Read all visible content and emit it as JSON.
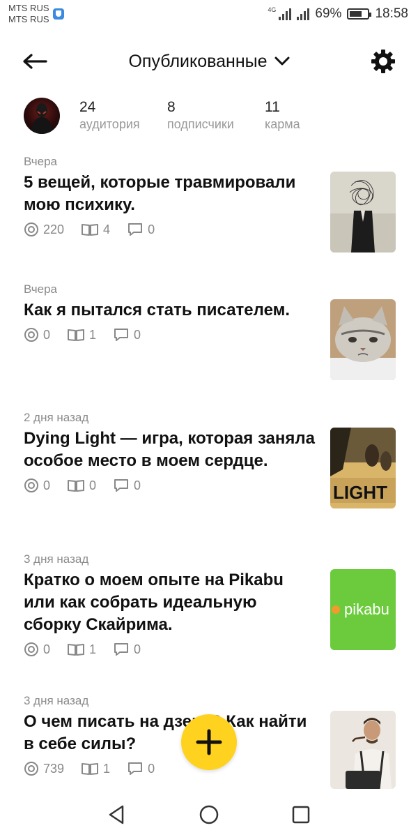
{
  "status_bar": {
    "carrier_1": "MTS RUS",
    "carrier_2": "MTS RUS",
    "network": "4G",
    "battery": "69%",
    "battery_level": 0.69,
    "time": "18:58"
  },
  "header": {
    "title": "Опубликованные"
  },
  "profile": {
    "stats": [
      {
        "value": "24",
        "label": "аудитория"
      },
      {
        "value": "8",
        "label": "подписчики"
      },
      {
        "value": "11",
        "label": "карма"
      }
    ]
  },
  "posts": [
    {
      "date": "Вчера",
      "title": "5 вещей, которые травмировали мою психику.",
      "views": "220",
      "reads": "4",
      "comments": "0",
      "thumb": "abstract-man"
    },
    {
      "date": "Вчера",
      "title": "Как я пытался стать писателем.",
      "views": "0",
      "reads": "1",
      "comments": "0",
      "thumb": "sad-cat"
    },
    {
      "date": "2 дня назад",
      "title": "Dying Light — игра, которая заняла особое место в моем сердце.",
      "views": "0",
      "reads": "0",
      "comments": "0",
      "thumb": "dying-light-cover",
      "thumb_text": "LIGHT"
    },
    {
      "date": "3 дня назад",
      "title": "Кратко о моем опыте на Pikabu или как собрать идеальную сборку Скайрима.",
      "views": "0",
      "reads": "1",
      "comments": "0",
      "thumb": "pikabu-logo",
      "thumb_text": "pikabu"
    },
    {
      "date": "3 дня назад",
      "title": "О чем писать на дзене? Как найти в себе силы?",
      "views": "739",
      "reads": "1",
      "comments": "0",
      "thumb": "man-at-typewriter"
    }
  ],
  "colors": {
    "fab": "#ffd21f",
    "pikabu_green": "#6ccb3c"
  },
  "icons": {
    "back": "arrow-left-icon",
    "dropdown": "chevron-down-icon",
    "settings": "gear-icon",
    "views": "eye-circle-icon",
    "reads": "book-icon",
    "comments": "comment-icon",
    "fab": "plus-icon"
  }
}
